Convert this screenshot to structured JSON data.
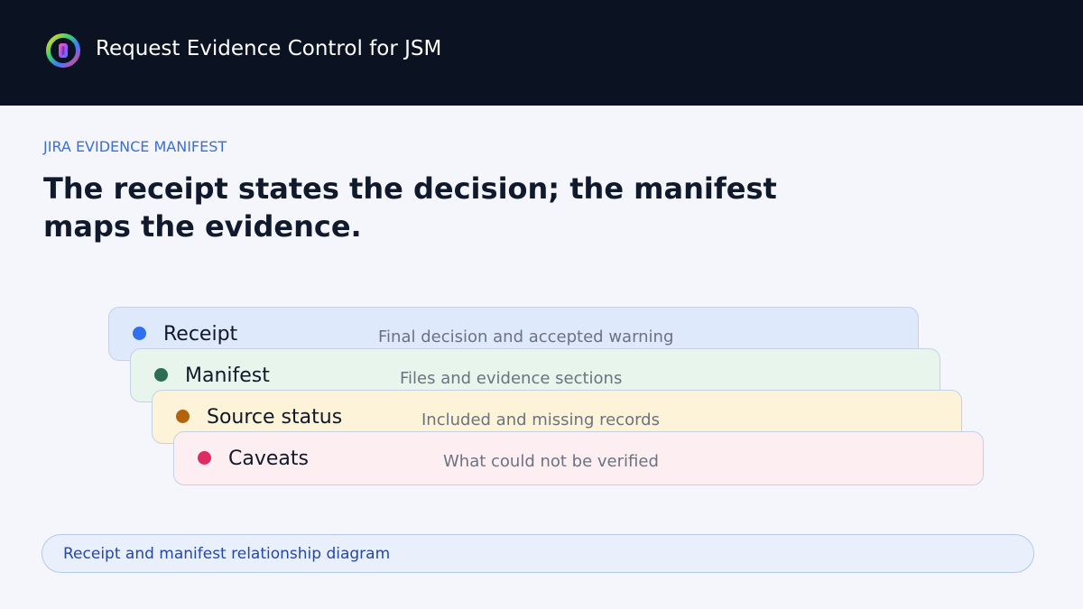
{
  "header": {
    "title": "Request Evidence Control for JSM",
    "logo_icon": "ring-logo-icon"
  },
  "section": {
    "eyebrow": "JIRA EVIDENCE MANIFEST",
    "headline": "The receipt states the decision; the manifest maps the evidence."
  },
  "layers": [
    {
      "label": "Receipt",
      "description": "Final decision and accepted warning",
      "bg": "#dfe9fc",
      "dot": "#2f6ff0"
    },
    {
      "label": "Manifest",
      "description": "Files and evidence sections",
      "bg": "#e8f5ed",
      "dot": "#2c6e55"
    },
    {
      "label": "Source status",
      "description": "Included and missing records",
      "bg": "#fdf3d8",
      "dot": "#b5620d"
    },
    {
      "label": "Caveats",
      "description": "What could not be verified",
      "bg": "#fdeef2",
      "dot": "#de2c63"
    }
  ],
  "caption": "Receipt and manifest relationship diagram"
}
